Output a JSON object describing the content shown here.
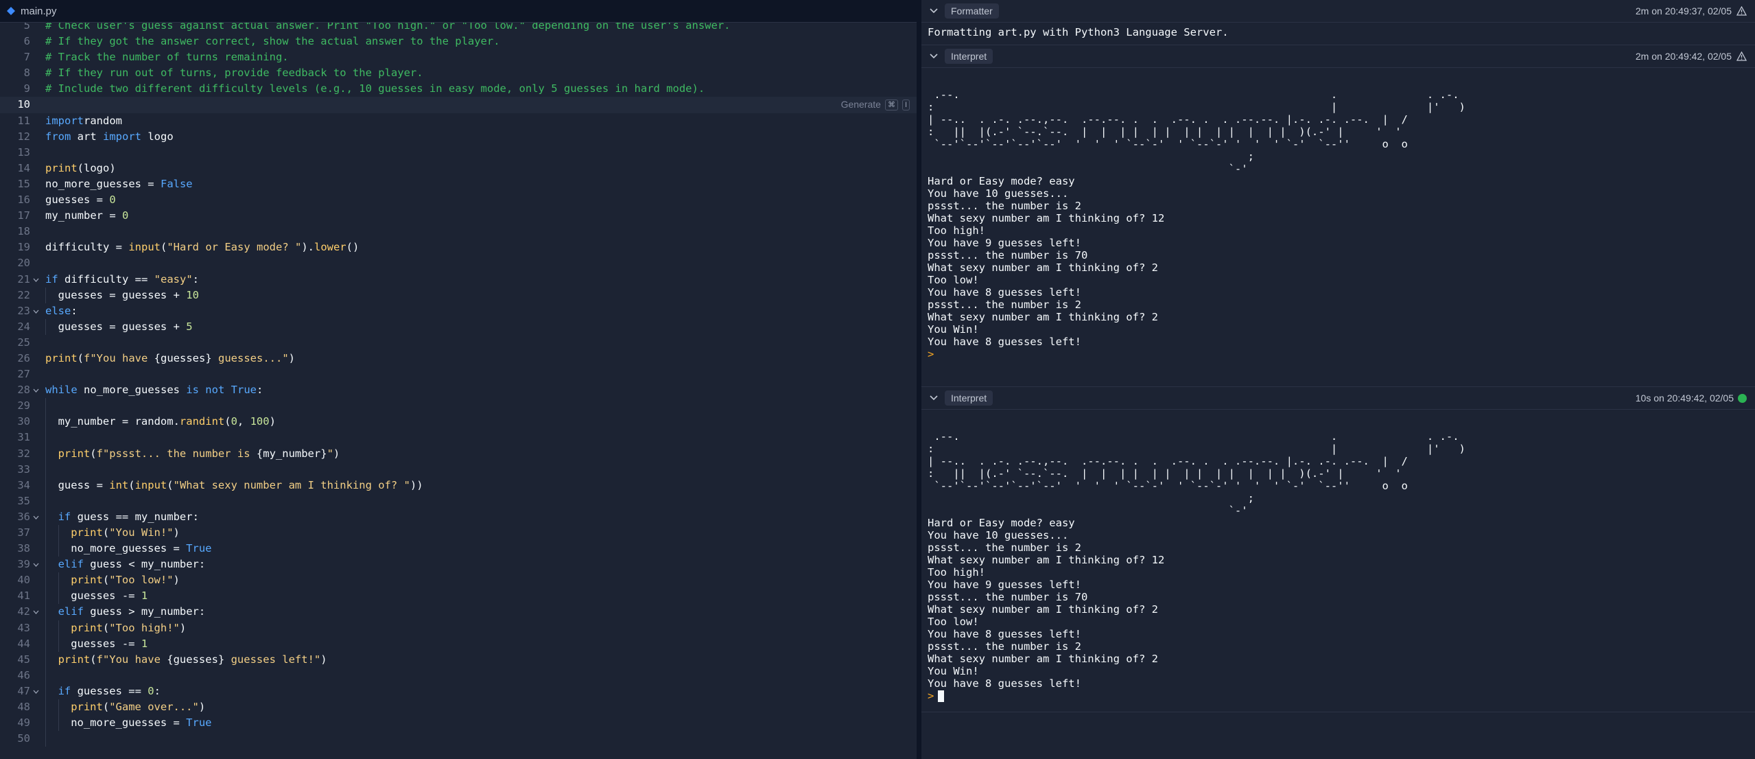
{
  "editor": {
    "tab": {
      "name": "main.py",
      "icon": "python-file-icon"
    },
    "generate": {
      "label": "Generate",
      "key1": "⌘",
      "key2": "I"
    },
    "lines": [
      {
        "n": "5",
        "t": [
          [
            "cm",
            "# Check user's guess against actual answer. Print \"Too high.\" or \"Too low.\" depending on the user's answer."
          ]
        ]
      },
      {
        "n": "6",
        "t": [
          [
            "cm",
            "# If they got the answer correct, show the actual answer to the player."
          ]
        ]
      },
      {
        "n": "7",
        "t": [
          [
            "cm",
            "# Track the number of turns remaining."
          ]
        ]
      },
      {
        "n": "8",
        "t": [
          [
            "cm",
            "# If they run out of turns, provide feedback to the player."
          ]
        ]
      },
      {
        "n": "9",
        "t": [
          [
            "cm",
            "# Include two different difficulty levels (e.g., 10 guesses in easy mode, only 5 guesses in hard mode)."
          ]
        ]
      },
      {
        "n": "10",
        "active": true,
        "t": []
      },
      {
        "n": "11",
        "t": [
          [
            "kw",
            "import"
          ],
          [
            "",
            "random"
          ]
        ]
      },
      {
        "n": "12",
        "t": [
          [
            "kw",
            "from"
          ],
          [
            "",
            " art "
          ],
          [
            "kw",
            "import"
          ],
          [
            "",
            " logo"
          ]
        ]
      },
      {
        "n": "13",
        "t": []
      },
      {
        "n": "14",
        "t": [
          [
            "fn",
            "print"
          ],
          [
            "",
            "(logo)"
          ]
        ]
      },
      {
        "n": "15",
        "t": [
          [
            "",
            "no_more_guesses = "
          ],
          [
            "kw",
            "False"
          ]
        ]
      },
      {
        "n": "16",
        "t": [
          [
            "",
            "guesses = "
          ],
          [
            "num",
            "0"
          ]
        ]
      },
      {
        "n": "17",
        "t": [
          [
            "",
            "my_number = "
          ],
          [
            "num",
            "0"
          ]
        ]
      },
      {
        "n": "18",
        "t": []
      },
      {
        "n": "19",
        "t": [
          [
            "",
            "difficulty = "
          ],
          [
            "fn",
            "input"
          ],
          [
            "",
            "("
          ],
          [
            "str",
            "\"Hard or Easy mode? \""
          ],
          [
            "",
            ")."
          ],
          [
            "fn",
            "lower"
          ],
          [
            "",
            "()"
          ]
        ]
      },
      {
        "n": "20",
        "t": []
      },
      {
        "n": "21",
        "fold": true,
        "t": [
          [
            "kw",
            "if"
          ],
          [
            "",
            " difficulty == "
          ],
          [
            "str",
            "\"easy\""
          ],
          [
            "",
            ":"
          ]
        ]
      },
      {
        "n": "22",
        "indent": 1,
        "t": [
          [
            "",
            "guesses = guesses + "
          ],
          [
            "num",
            "10"
          ]
        ]
      },
      {
        "n": "23",
        "fold": true,
        "t": [
          [
            "kw",
            "else"
          ],
          [
            "",
            ":"
          ]
        ]
      },
      {
        "n": "24",
        "indent": 1,
        "t": [
          [
            "",
            "guesses = guesses + "
          ],
          [
            "num",
            "5"
          ]
        ]
      },
      {
        "n": "25",
        "t": []
      },
      {
        "n": "26",
        "t": [
          [
            "fn",
            "print"
          ],
          [
            "",
            "("
          ],
          [
            "str",
            "f\"You have "
          ],
          [
            "",
            "{guesses}"
          ],
          [
            "str",
            " guesses...\""
          ],
          [
            "",
            ")"
          ]
        ]
      },
      {
        "n": "27",
        "t": []
      },
      {
        "n": "28",
        "fold": true,
        "t": [
          [
            "kw",
            "while"
          ],
          [
            "",
            " no_more_guesses "
          ],
          [
            "kw",
            "is not"
          ],
          [
            "",
            " "
          ],
          [
            "kw",
            "True"
          ],
          [
            "",
            ":"
          ]
        ]
      },
      {
        "n": "29",
        "indent": 1,
        "t": []
      },
      {
        "n": "30",
        "indent": 1,
        "t": [
          [
            "",
            "my_number = random."
          ],
          [
            "fn",
            "randint"
          ],
          [
            "",
            "("
          ],
          [
            "num",
            "0"
          ],
          [
            "",
            ", "
          ],
          [
            "num",
            "100"
          ],
          [
            "",
            ")"
          ]
        ]
      },
      {
        "n": "31",
        "indent": 1,
        "t": []
      },
      {
        "n": "32",
        "indent": 1,
        "t": [
          [
            "fn",
            "print"
          ],
          [
            "",
            "("
          ],
          [
            "str",
            "f\"pssst... the number is "
          ],
          [
            "",
            "{my_number}"
          ],
          [
            "str",
            "\""
          ],
          [
            "",
            ")"
          ]
        ]
      },
      {
        "n": "33",
        "indent": 1,
        "t": []
      },
      {
        "n": "34",
        "indent": 1,
        "t": [
          [
            "",
            "guess = "
          ],
          [
            "fn",
            "int"
          ],
          [
            "",
            "("
          ],
          [
            "fn",
            "input"
          ],
          [
            "",
            "("
          ],
          [
            "str",
            "\"What sexy number am I thinking of? \""
          ],
          [
            "",
            "))"
          ]
        ]
      },
      {
        "n": "35",
        "indent": 1,
        "t": []
      },
      {
        "n": "36",
        "indent": 1,
        "fold": true,
        "t": [
          [
            "kw",
            "if"
          ],
          [
            "",
            " guess == my_number:"
          ]
        ]
      },
      {
        "n": "37",
        "indent": 2,
        "t": [
          [
            "fn",
            "print"
          ],
          [
            "",
            "("
          ],
          [
            "str",
            "\"You Win!\""
          ],
          [
            "",
            ")"
          ]
        ]
      },
      {
        "n": "38",
        "indent": 2,
        "t": [
          [
            "",
            "no_more_guesses = "
          ],
          [
            "kw",
            "True"
          ]
        ]
      },
      {
        "n": "39",
        "indent": 1,
        "fold": true,
        "t": [
          [
            "kw",
            "elif"
          ],
          [
            "",
            " guess < my_number:"
          ]
        ]
      },
      {
        "n": "40",
        "indent": 2,
        "t": [
          [
            "fn",
            "print"
          ],
          [
            "",
            "("
          ],
          [
            "str",
            "\"Too low!\""
          ],
          [
            "",
            ")"
          ]
        ]
      },
      {
        "n": "41",
        "indent": 2,
        "t": [
          [
            "",
            "guesses -= "
          ],
          [
            "num",
            "1"
          ]
        ]
      },
      {
        "n": "42",
        "indent": 1,
        "fold": true,
        "t": [
          [
            "kw",
            "elif"
          ],
          [
            "",
            " guess > my_number:"
          ]
        ]
      },
      {
        "n": "43",
        "indent": 2,
        "t": [
          [
            "fn",
            "print"
          ],
          [
            "",
            "("
          ],
          [
            "str",
            "\"Too high!\""
          ],
          [
            "",
            ")"
          ]
        ]
      },
      {
        "n": "44",
        "indent": 2,
        "t": [
          [
            "",
            "guesses -= "
          ],
          [
            "num",
            "1"
          ]
        ]
      },
      {
        "n": "45",
        "indent": 1,
        "t": [
          [
            "fn",
            "print"
          ],
          [
            "",
            "("
          ],
          [
            "str",
            "f\"You have "
          ],
          [
            "",
            "{guesses}"
          ],
          [
            "str",
            " guesses left!\""
          ],
          [
            "",
            ")"
          ]
        ]
      },
      {
        "n": "46",
        "indent": 1,
        "t": []
      },
      {
        "n": "47",
        "indent": 1,
        "fold": true,
        "t": [
          [
            "kw",
            "if"
          ],
          [
            "",
            " guesses == "
          ],
          [
            "num",
            "0"
          ],
          [
            "",
            ":"
          ]
        ]
      },
      {
        "n": "48",
        "indent": 2,
        "t": [
          [
            "fn",
            "print"
          ],
          [
            "",
            "("
          ],
          [
            "str",
            "\"Game over...\""
          ],
          [
            "",
            ")"
          ]
        ]
      },
      {
        "n": "49",
        "indent": 2,
        "t": [
          [
            "",
            "no_more_guesses = "
          ],
          [
            "kw",
            "True"
          ]
        ]
      },
      {
        "n": "50",
        "indent": 1,
        "t": []
      }
    ]
  },
  "console": {
    "formatter": {
      "tag": "Formatter",
      "meta": "2m on 20:49:37, 02/05",
      "status_icon": "warning-icon",
      "text": "Formatting art.py with Python3 Language Server."
    },
    "interpret1": {
      "tag": "Interpret",
      "meta": "2m on 20:49:42, 02/05",
      "status_icon": "warning-icon",
      "output": " .--.                                                          .              . .-.\n:                                                              |              |'   )\n| --..  . .-. .--.,--.  .--.--. .  .  .--. .  . .--.--. |.-. .-. .--.  |  /\n:   ||  |(.-' `--.`--.  |  |  | |  | |  | |  | |  |  | |  )(.-' |     '  '\n `--'`--'`--'`--'`--'  '  '  ' `--`-'  ' `--`-' '  '  ' `-'  `--''     o  o\n                                                  ;\n                                               `-'\nHard or Easy mode? easy\nYou have 10 guesses...\npssst... the number is 2\nWhat sexy number am I thinking of? 12\nToo high!\nYou have 9 guesses left!\npssst... the number is 70\nWhat sexy number am I thinking of? 2\nToo low!\nYou have 8 guesses left!\npssst... the number is 2\nWhat sexy number am I thinking of? 2\nYou Win!\nYou have 8 guesses left!",
      "prompt": ">"
    },
    "interpret2": {
      "tag": "Interpret",
      "meta": "10s on 20:49:42, 02/05",
      "status_icon": "success-dot-icon",
      "output": " .--.                                                          .              . .-.\n:                                                              |              |'   )\n| --..  . .-. .--.,--.  .--.--. .  .  .--. .  . .--.--. |.-. .-. .--.  |  /\n:   ||  |(.-' `--.`--.  |  |  | |  | |  | |  | |  |  | |  )(.-' |     '  '\n `--'`--'`--'`--'`--'  '  '  ' `--`-'  ' `--`-' '  '  ' `-'  `--''     o  o\n                                                  ;\n                                               `-'\nHard or Easy mode? easy\nYou have 10 guesses...\npssst... the number is 2\nWhat sexy number am I thinking of? 12\nToo high!\nYou have 9 guesses left!\npssst... the number is 70\nWhat sexy number am I thinking of? 2\nToo low!\nYou have 8 guesses left!\npssst... the number is 2\nWhat sexy number am I thinking of? 2\nYou Win!\nYou have 8 guesses left!",
      "prompt": ">"
    }
  }
}
